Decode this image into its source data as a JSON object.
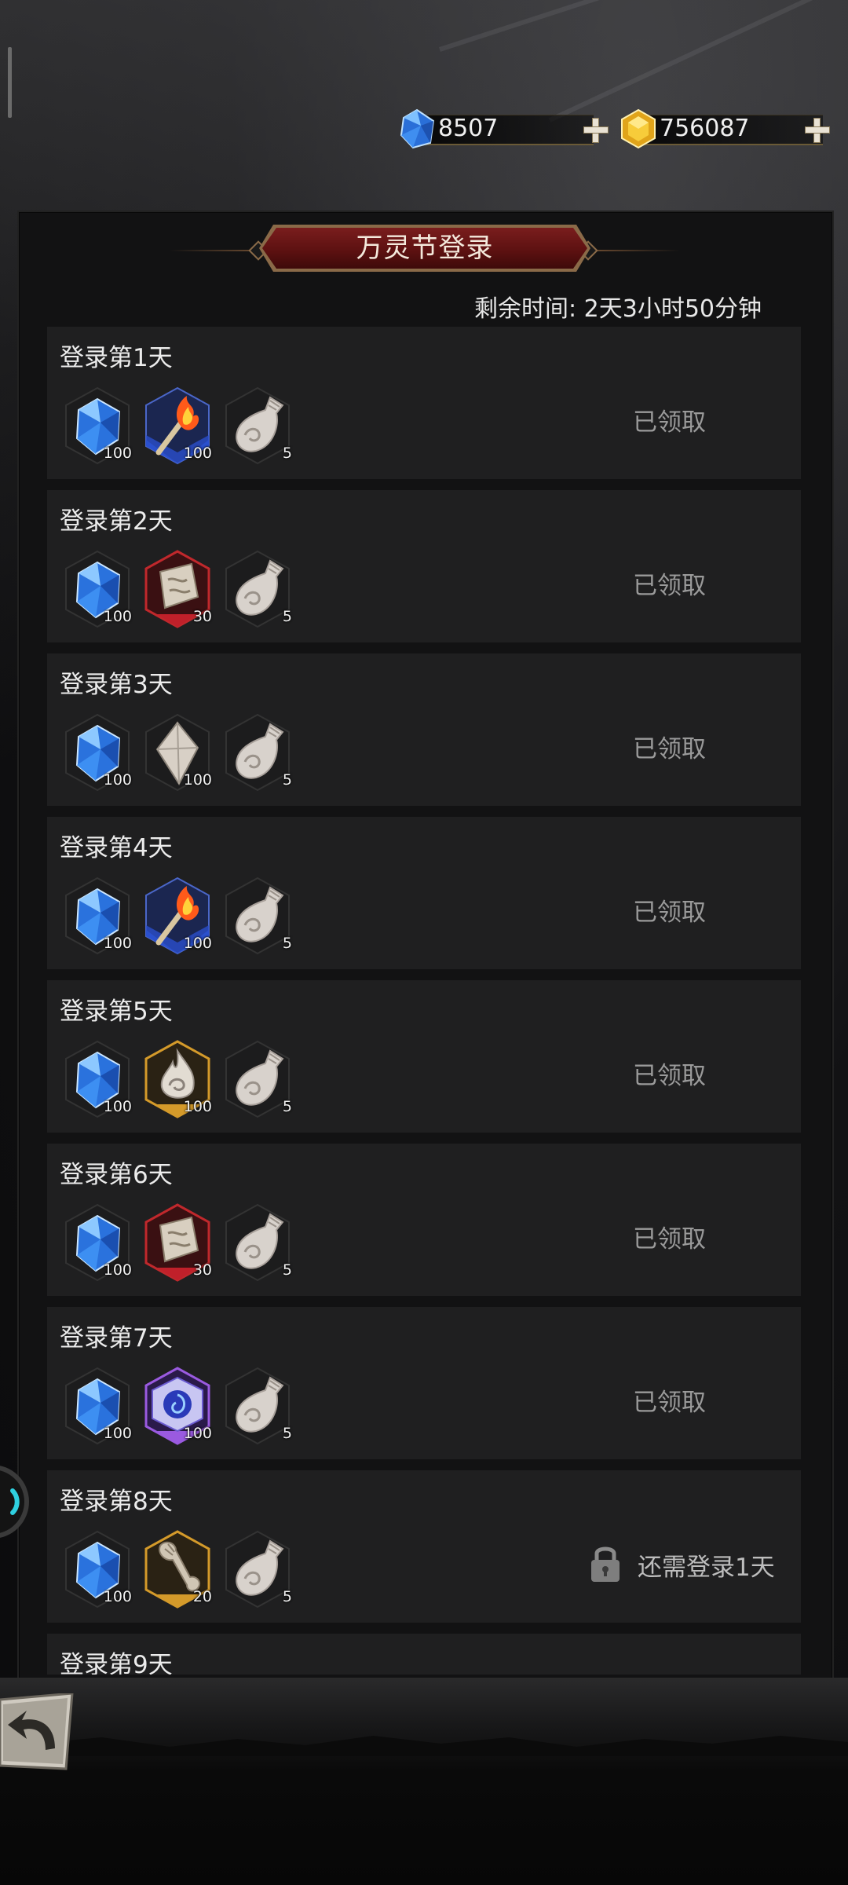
{
  "currency": {
    "blue_gem_value": "8507",
    "gold_gem_value": "756087"
  },
  "event": {
    "title": "万灵节登录",
    "remaining_time": "剩余时间: 2天3小时50分钟"
  },
  "rows": [
    {
      "day": "登录第1天",
      "status": "已领取",
      "items": [
        {
          "icon": "blue-crystal-icon",
          "qty": "100"
        },
        {
          "icon": "fire-torch-icon",
          "qty": "100"
        },
        {
          "icon": "conch-shell-icon",
          "qty": "5"
        }
      ]
    },
    {
      "day": "登录第2天",
      "status": "已领取",
      "items": [
        {
          "icon": "blue-crystal-icon",
          "qty": "100"
        },
        {
          "icon": "stone-scroll-icon",
          "qty": "30"
        },
        {
          "icon": "conch-shell-icon",
          "qty": "5"
        }
      ]
    },
    {
      "day": "登录第3天",
      "status": "已领取",
      "items": [
        {
          "icon": "blue-crystal-icon",
          "qty": "100"
        },
        {
          "icon": "stone-shard-icon",
          "qty": "100"
        },
        {
          "icon": "conch-shell-icon",
          "qty": "5"
        }
      ]
    },
    {
      "day": "登录第4天",
      "status": "已领取",
      "items": [
        {
          "icon": "blue-crystal-icon",
          "qty": "100"
        },
        {
          "icon": "fire-torch-icon",
          "qty": "100"
        },
        {
          "icon": "conch-shell-icon",
          "qty": "5"
        }
      ]
    },
    {
      "day": "登录第5天",
      "status": "已领取",
      "items": [
        {
          "icon": "blue-crystal-icon",
          "qty": "100"
        },
        {
          "icon": "spirit-flame-icon",
          "qty": "100"
        },
        {
          "icon": "conch-shell-icon",
          "qty": "5"
        }
      ]
    },
    {
      "day": "登录第6天",
      "status": "已领取",
      "items": [
        {
          "icon": "blue-crystal-icon",
          "qty": "100"
        },
        {
          "icon": "stone-scroll-icon",
          "qty": "30"
        },
        {
          "icon": "conch-shell-icon",
          "qty": "5"
        }
      ]
    },
    {
      "day": "登录第7天",
      "status": "已领取",
      "items": [
        {
          "icon": "blue-crystal-icon",
          "qty": "100"
        },
        {
          "icon": "vortex-cube-icon",
          "qty": "100"
        },
        {
          "icon": "conch-shell-icon",
          "qty": "5"
        }
      ]
    },
    {
      "day": "登录第8天",
      "status": "还需登录1天",
      "items": [
        {
          "icon": "blue-crystal-icon",
          "qty": "100"
        },
        {
          "icon": "bone-club-icon",
          "qty": "20"
        },
        {
          "icon": "conch-shell-icon",
          "qty": "5"
        }
      ]
    },
    {
      "day": "登录第9天"
    }
  ],
  "colors": {
    "title_banner": "#6a1515",
    "row_bg": "#1f1f20",
    "claimed_text": "#9a9a9a"
  }
}
